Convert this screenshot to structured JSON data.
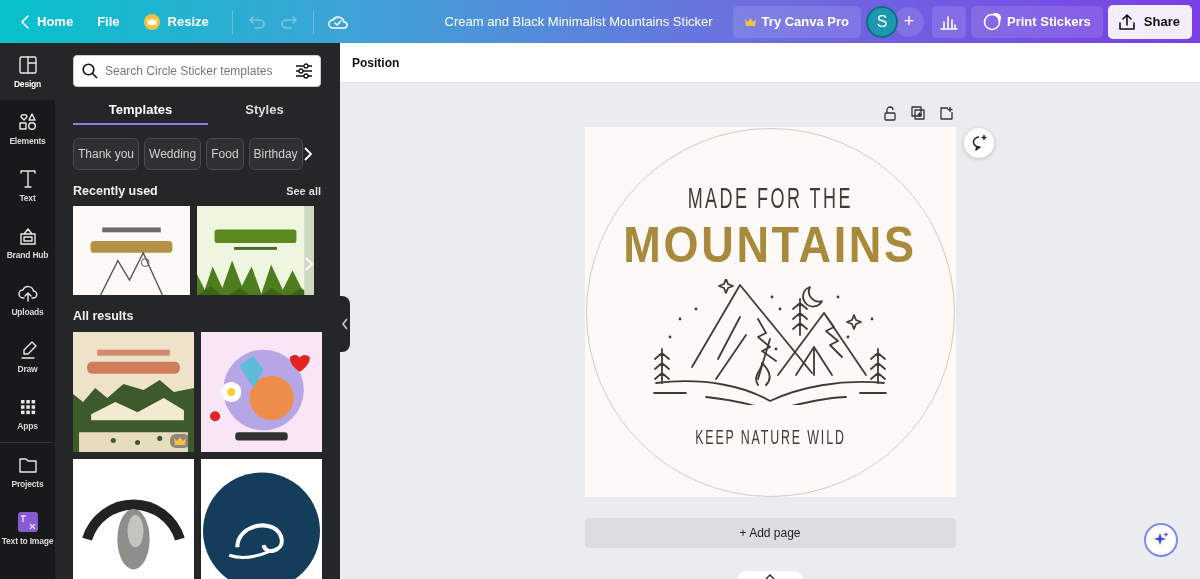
{
  "topbar": {
    "nav": [
      {
        "label": "Home",
        "kind": "back"
      },
      {
        "label": "File",
        "kind": "plain"
      },
      {
        "label": "Resize",
        "kind": "crown"
      }
    ],
    "undo": {
      "disabled": true
    },
    "redo": {
      "disabled": true
    },
    "title": "Cream and Black Minimalist Mountains Sticker",
    "pro_button": "Try Canva Pro",
    "avatar": "S",
    "add_button": "+",
    "print_button": "Print Stickers",
    "share_button": "Share"
  },
  "sidebar": {
    "items": [
      {
        "label": "Design",
        "kind": "design",
        "selected": true
      },
      {
        "label": "Elements",
        "kind": "elements",
        "selected": false
      },
      {
        "label": "Text",
        "kind": "text",
        "selected": false
      },
      {
        "label": "Brand Hub",
        "kind": "brand",
        "selected": false
      },
      {
        "label": "Uploads",
        "kind": "uploads",
        "selected": false
      },
      {
        "label": "Draw",
        "kind": "draw",
        "selected": false
      },
      {
        "label": "Apps",
        "kind": "apps",
        "selected": false
      },
      {
        "label": "Projects",
        "kind": "projects",
        "selected": false
      },
      {
        "label": "Text to Image",
        "kind": "app",
        "selected": false
      }
    ]
  },
  "panel": {
    "search": {
      "placeholder": "Search Circle Sticker templates"
    },
    "tabs": [
      {
        "label": "Templates",
        "selected": true
      },
      {
        "label": "Styles",
        "selected": false
      }
    ],
    "chips": [
      "Thank you",
      "Wedding",
      "Food",
      "Birthday"
    ],
    "recent": {
      "heading": "Recently used",
      "link": "See all",
      "thumbs": [
        {
          "kind": "picture"
        },
        {
          "kind": "picture"
        }
      ]
    },
    "results": {
      "heading": "All results",
      "thumbs": [
        {
          "kind": "picture",
          "premium": true
        },
        {
          "kind": "picture",
          "premium": false
        },
        {
          "kind": "picture",
          "premium": false
        },
        {
          "kind": "picture",
          "premium": false
        }
      ]
    }
  },
  "toolbar": {
    "label": "Position"
  },
  "page": {
    "heading": "MADE FOR THE",
    "title": "MOUNTAINS",
    "tagline": "KEEP NATURE WILD"
  },
  "add_page": "+ Add page"
}
